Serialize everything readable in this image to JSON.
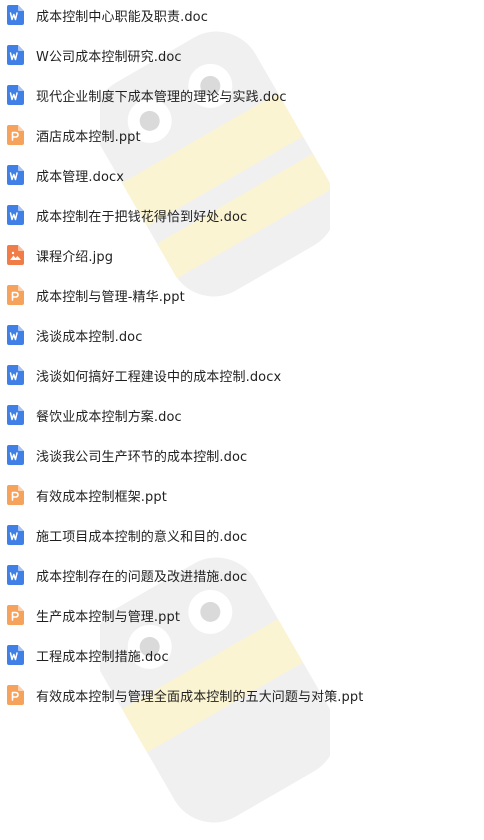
{
  "colors": {
    "doc_icon": "#3f7fe6",
    "ppt_icon": "#f5a35c",
    "jpg_icon": "#f07d48",
    "text": "#1f1f1f",
    "watermark_gray": "#e6e6e6",
    "watermark_yellow": "#fdf6d6"
  },
  "files": [
    {
      "name": "成本控制中心职能及职责.doc",
      "icon": "word-icon"
    },
    {
      "name": "W公司成本控制研究.doc",
      "icon": "word-icon"
    },
    {
      "name": "现代企业制度下成本管理的理论与实践.doc",
      "icon": "word-icon"
    },
    {
      "name": "酒店成本控制.ppt",
      "icon": "ppt-icon"
    },
    {
      "name": "成本管理.docx",
      "icon": "word-icon"
    },
    {
      "name": "成本控制在于把钱花得恰到好处.doc",
      "icon": "word-icon"
    },
    {
      "name": "课程介绍.jpg",
      "icon": "image-icon"
    },
    {
      "name": "成本控制与管理-精华.ppt",
      "icon": "ppt-icon"
    },
    {
      "name": "浅谈成本控制.doc",
      "icon": "word-icon"
    },
    {
      "name": "浅谈如何搞好工程建设中的成本控制.docx",
      "icon": "word-icon"
    },
    {
      "name": "餐饮业成本控制方案.doc",
      "icon": "word-icon"
    },
    {
      "name": "浅谈我公司生产环节的成本控制.doc",
      "icon": "word-icon"
    },
    {
      "name": "有效成本控制框架.ppt",
      "icon": "ppt-icon"
    },
    {
      "name": "施工项目成本控制的意义和目的.doc",
      "icon": "word-icon"
    },
    {
      "name": "成本控制存在的问题及改进措施.doc",
      "icon": "word-icon"
    },
    {
      "name": "生产成本控制与管理.ppt",
      "icon": "ppt-icon"
    },
    {
      "name": "工程成本控制措施.doc",
      "icon": "word-icon"
    },
    {
      "name": "有效成本控制与管理全面成本控制的五大问题与对策.ppt",
      "icon": "ppt-icon"
    }
  ]
}
